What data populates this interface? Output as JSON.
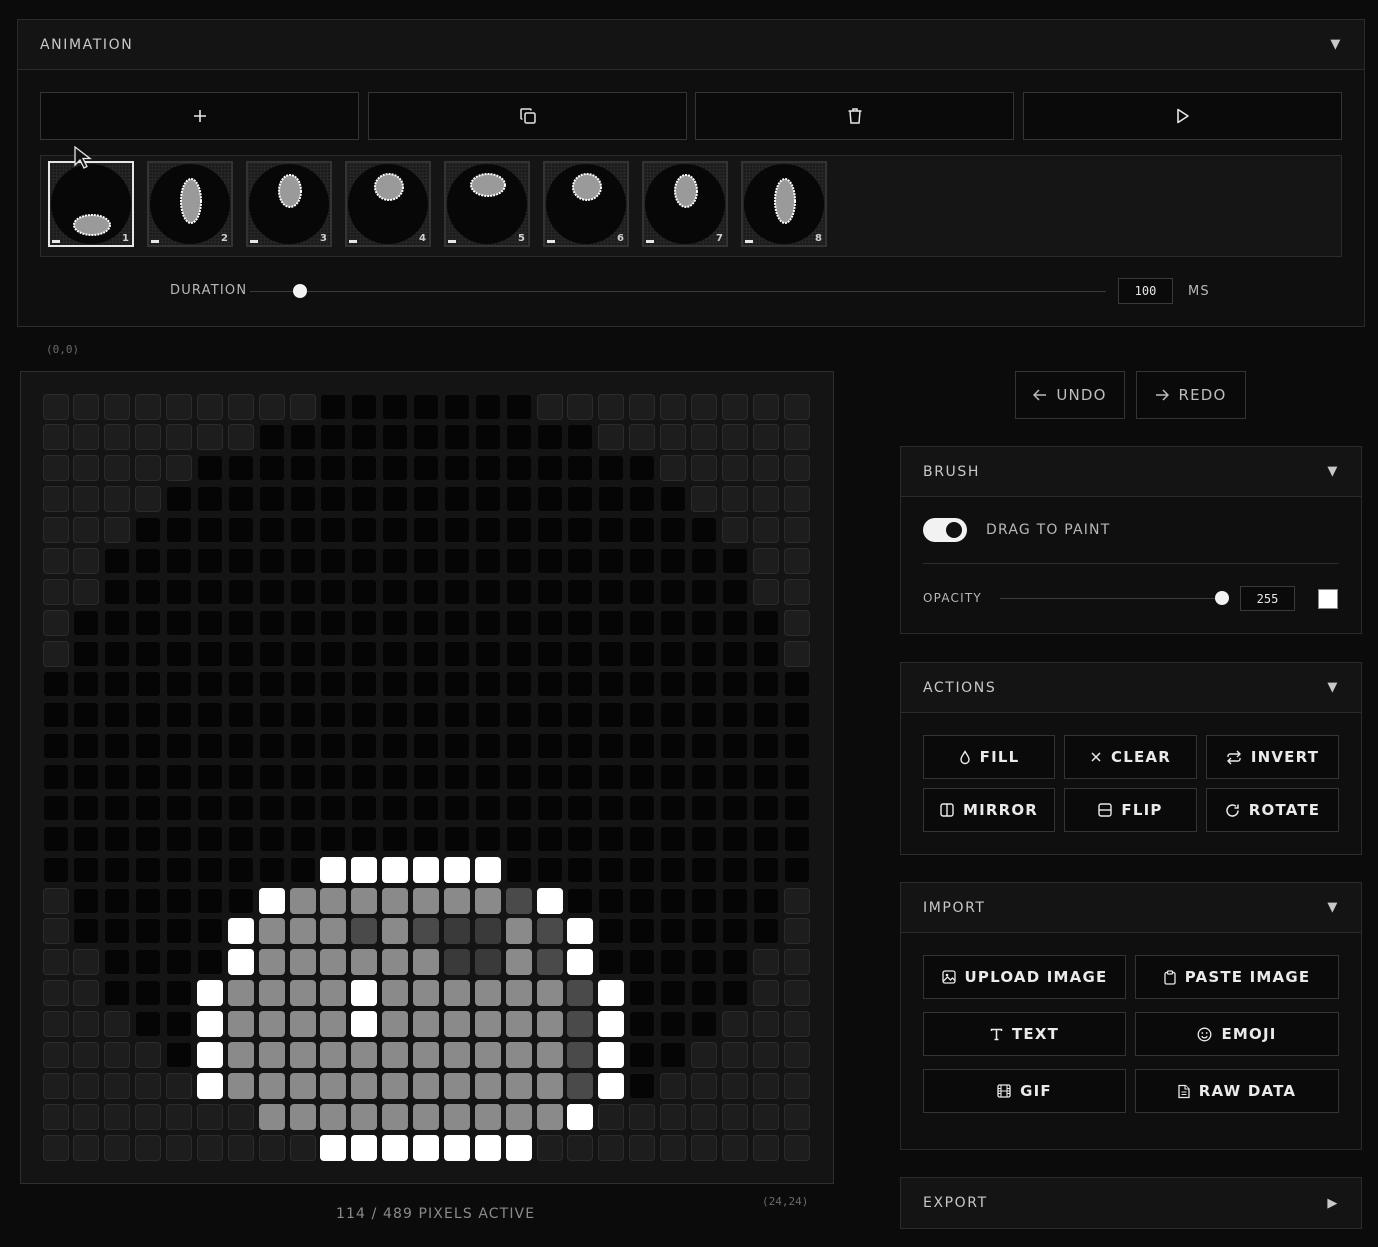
{
  "animation": {
    "title": "ANIMATION",
    "caret": "▼",
    "toolbar": [
      {
        "name": "add-frame-button",
        "icon": "plus-icon"
      },
      {
        "name": "duplicate-frame-button",
        "icon": "copy-icon"
      },
      {
        "name": "delete-frame-button",
        "icon": "trash-icon"
      },
      {
        "name": "play-button",
        "icon": "play-icon"
      }
    ],
    "frames": [
      {
        "number": "1",
        "active": true
      },
      {
        "number": "2"
      },
      {
        "number": "3"
      },
      {
        "number": "4"
      },
      {
        "number": "5"
      },
      {
        "number": "6"
      },
      {
        "number": "7"
      },
      {
        "number": "8"
      }
    ],
    "duration_label": "DURATION",
    "duration_value": "100",
    "duration_unit": "MS",
    "duration_fraction": 0.058
  },
  "canvas": {
    "origin_label": "(0,0)",
    "end_label": "(24,24)",
    "status": "114 / 489 PIXELS ACTIVE",
    "size": 25
  },
  "history": {
    "undo_label": "UNDO",
    "redo_label": "REDO"
  },
  "brush": {
    "title": "BRUSH",
    "caret": "▼",
    "drag_to_paint_label": "DRAG TO PAINT",
    "drag_to_paint_on": true,
    "opacity_label": "OPACITY",
    "opacity_value": "255",
    "opacity_fraction": 1.0,
    "color": "#ffffff"
  },
  "actions": {
    "title": "ACTIONS",
    "caret": "▼",
    "buttons": [
      {
        "label": "FILL",
        "icon": "droplet-icon"
      },
      {
        "label": "CLEAR",
        "icon": "x-icon"
      },
      {
        "label": "INVERT",
        "icon": "swap-icon"
      },
      {
        "label": "MIRROR",
        "icon": "mirror-icon"
      },
      {
        "label": "FLIP",
        "icon": "flip-icon"
      },
      {
        "label": "ROTATE",
        "icon": "rotate-icon"
      }
    ]
  },
  "import": {
    "title": "IMPORT",
    "caret": "▼",
    "buttons": [
      {
        "label": "UPLOAD IMAGE",
        "icon": "image-icon"
      },
      {
        "label": "PASTE IMAGE",
        "icon": "clipboard-icon"
      },
      {
        "label": "TEXT",
        "icon": "text-icon"
      },
      {
        "label": "EMOJI",
        "icon": "smile-icon"
      },
      {
        "label": "GIF",
        "icon": "film-icon"
      },
      {
        "label": "RAW DATA",
        "icon": "file-icon"
      }
    ]
  },
  "export": {
    "title": "EXPORT",
    "caret": "▶"
  }
}
